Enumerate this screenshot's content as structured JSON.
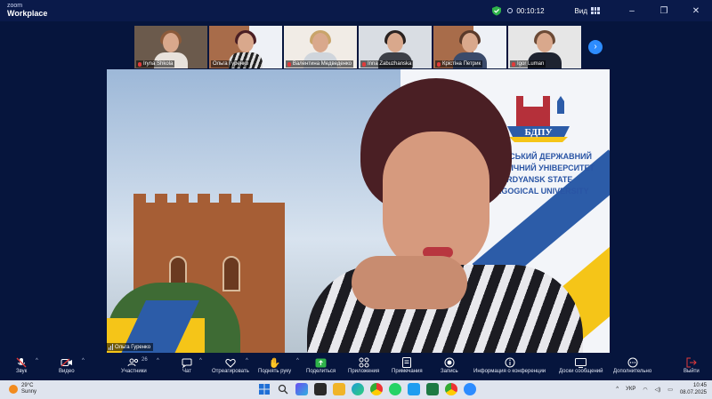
{
  "app": {
    "brand_top": "zoom",
    "brand_bottom": "Workplace",
    "timer": "00:10:12",
    "view_label": "Вид"
  },
  "window_controls": {
    "minimize": "–",
    "maximize": "❐",
    "close": "✕"
  },
  "participants": [
    {
      "name": "Iryna Shkola",
      "muted": true,
      "active": false
    },
    {
      "name": "Ольга Гуренко",
      "muted": false,
      "active": true
    },
    {
      "name": "Валентина Медведенко",
      "muted": true,
      "active": false
    },
    {
      "name": "Inna Zabuzhanska",
      "muted": true,
      "active": false
    },
    {
      "name": "Крістіна Петрик",
      "muted": true,
      "active": false
    },
    {
      "name": "Igor Luman",
      "muted": true,
      "active": false
    }
  ],
  "gallery_next": "›",
  "speaker": {
    "name": "Ольга Гуренко"
  },
  "university": {
    "abbr": "БДПУ",
    "line1": "БЕРДЯНСЬКИЙ ДЕРЖАВНИЙ",
    "line2": "ПЕДАГОГІЧНИЙ УНІВЕРСИТЕТ",
    "line3": "BERDYANSK STATE",
    "line4": "PEDAGOGICAL UNIVERSITY"
  },
  "toolbar": {
    "audio": "Звук",
    "video": "Видео",
    "participants": "Участники",
    "participants_count": "26",
    "chat": "Чат",
    "react": "Отреагировать",
    "raise_hand": "Поднять руку",
    "share": "Поделиться",
    "apps": "Приложения",
    "notes": "Примечания",
    "record": "Запись",
    "info": "Информация о конференции",
    "whiteboards": "Доски сообщений",
    "more": "Дополнительно",
    "leave": "Выйти"
  },
  "taskbar": {
    "temperature": "29°C",
    "condition": "Sunny",
    "language": "УКР",
    "time": "10:45",
    "date": "08.07.2025"
  },
  "colors": {
    "accent": "#2d8cff",
    "brand_blue": "#2c5ca8",
    "brand_yellow": "#f5c518",
    "muted_red": "#e23a3a"
  }
}
